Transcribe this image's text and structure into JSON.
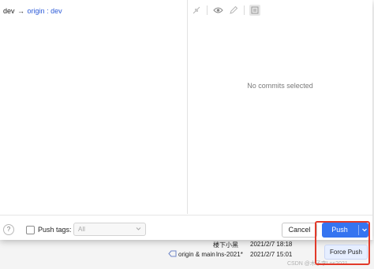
{
  "branch": {
    "source": "dev",
    "arrow": "→",
    "remote": "origin",
    "separator": ":",
    "target": "dev"
  },
  "details": {
    "empty_message": "No commits selected"
  },
  "footer": {
    "help_label": "?",
    "push_tags_label": "Push tags:",
    "push_tags_checked": false,
    "tags_select_value": "All",
    "cancel_label": "Cancel",
    "push_label": "Push"
  },
  "dropdown": {
    "force_push_label": "Force Push"
  },
  "background_log": {
    "rows": [
      {
        "author": "楼下小黑",
        "date": "2021/2/7 18:18"
      },
      {
        "refs": "origin & main",
        "author": "lns-2021*",
        "date": "2021/2/7 15:01"
      }
    ]
  },
  "watermark": "CSDN @木子李Lns2021",
  "colors": {
    "accent": "#3574f0",
    "branch_link": "#2b5ad8",
    "highlight_border": "#e23a2a"
  }
}
